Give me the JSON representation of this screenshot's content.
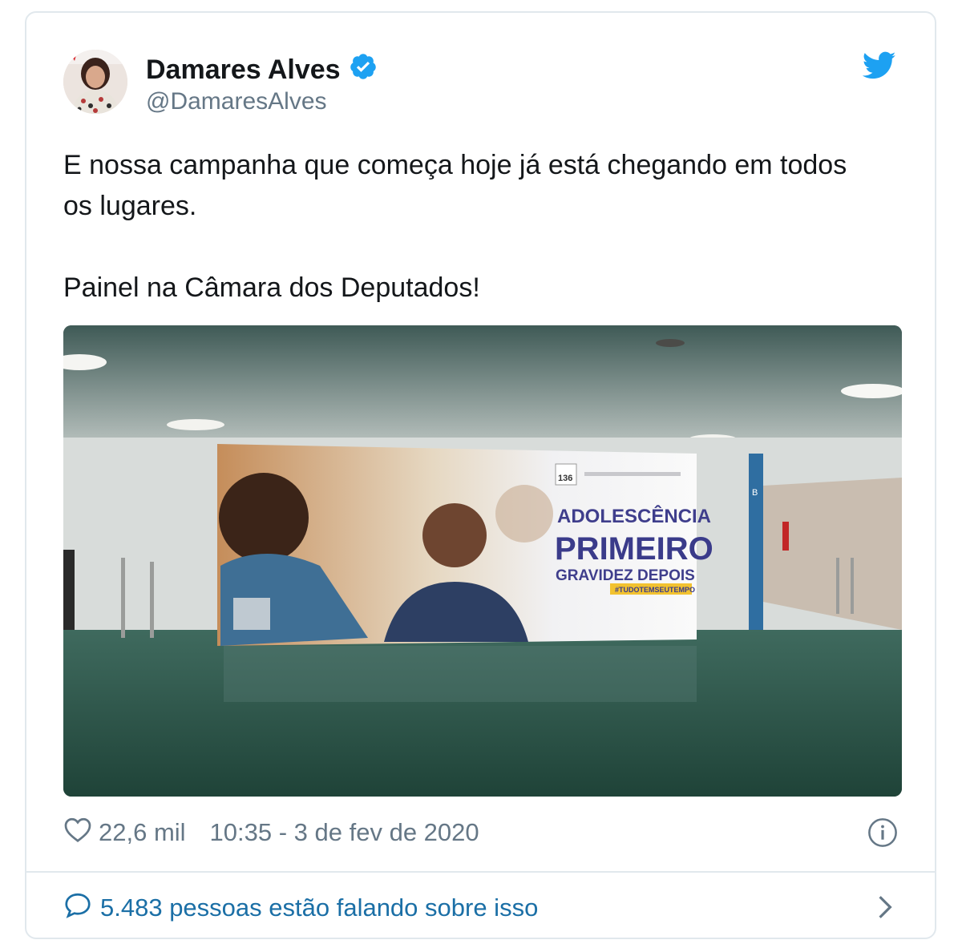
{
  "tweet": {
    "author_name": "Damares Alves",
    "author_handle": "@DamaresAlves",
    "text_line1": "E nossa campanha que começa hoje já está chegando em todos os lugares.",
    "text_line2": "Painel na Câmara dos Deputados!",
    "likes": "22,6 mil",
    "timestamp": "10:35 - 3 de fev de 2020",
    "conversation": "5.483 pessoas estão falando sobre isso"
  },
  "photo": {
    "banner_title1": "ADOLESCÊNCIA",
    "banner_title2": "PRIMEIRO",
    "banner_title3": "GRAVIDEZ DEPOIS",
    "banner_hashtag": "#TUDOTEMSEUTEMPO",
    "banner_number": "136",
    "wall_marker": "B"
  },
  "colors": {
    "verified": "#1da1f2",
    "twitter_blue": "#1da1f2",
    "link": "#1b6fa6",
    "muted": "#657786"
  },
  "icons": [
    "verified-icon",
    "twitter-bird-icon",
    "heart-icon",
    "info-icon",
    "speech-bubble-icon",
    "chevron-right-icon"
  ]
}
